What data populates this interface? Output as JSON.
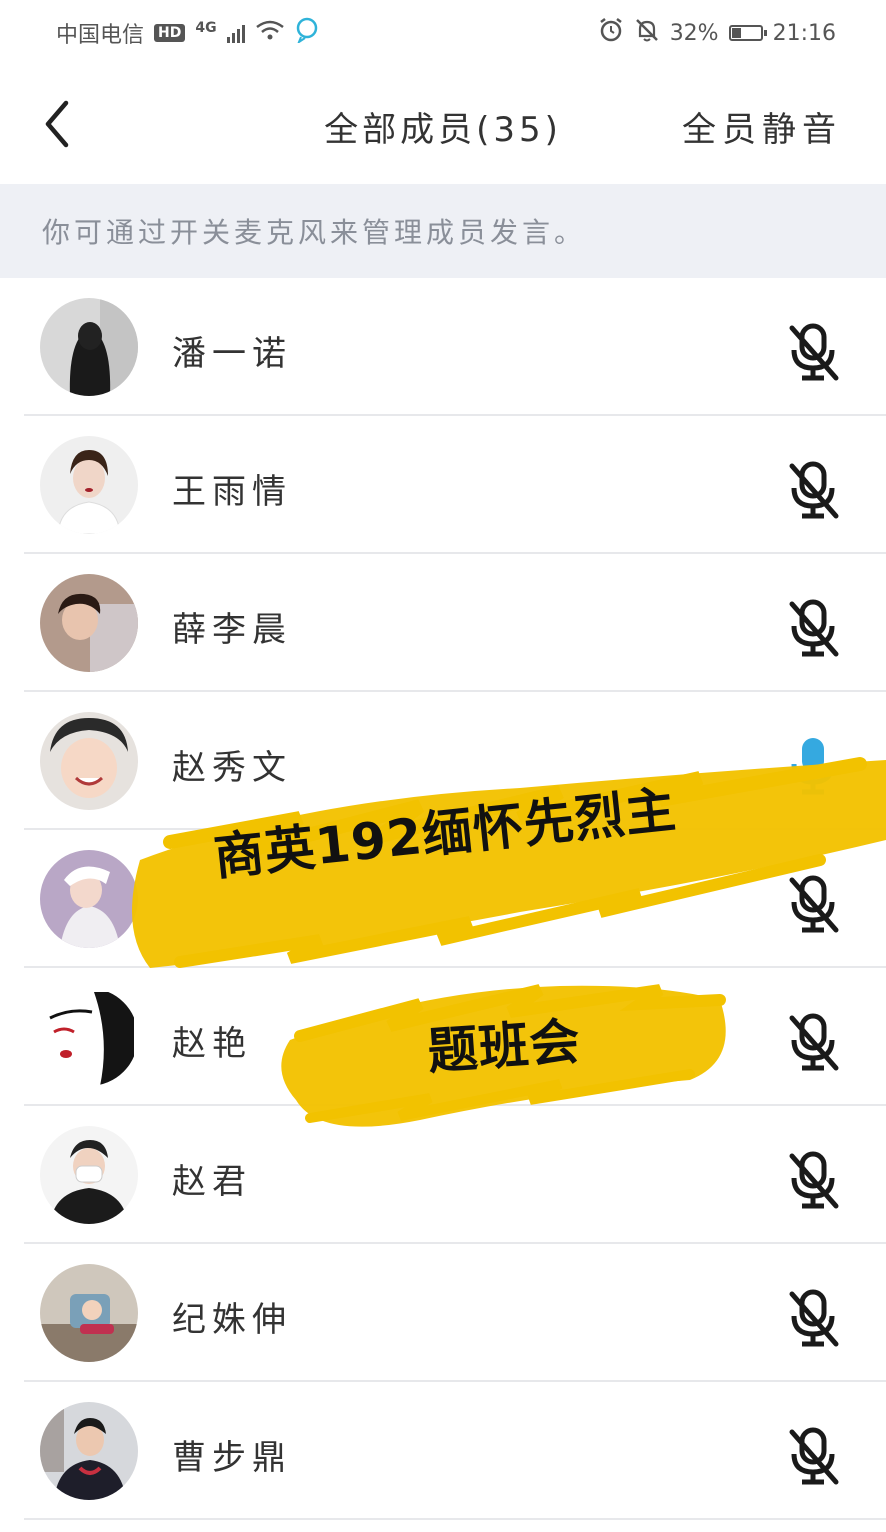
{
  "status_bar": {
    "carrier": "中国电信",
    "hd": "HD",
    "network": "4G",
    "battery_percent": "32%",
    "battery_level": 0.32,
    "time": "21:16"
  },
  "header": {
    "title": "全部成员(35)",
    "mute_all_label": "全员静音"
  },
  "hint": "你可通过开关麦克风来管理成员发言。",
  "members": [
    {
      "name": "潘一诺",
      "mic": "muted"
    },
    {
      "name": "王雨情",
      "mic": "muted"
    },
    {
      "name": "薛李晨",
      "mic": "muted"
    },
    {
      "name": "赵秀文",
      "mic": "on"
    },
    {
      "name": "",
      "mic": "muted"
    },
    {
      "name": "赵艳",
      "mic": "muted"
    },
    {
      "name": "赵君",
      "mic": "muted"
    },
    {
      "name": "纪姝伸",
      "mic": "muted"
    },
    {
      "name": "曹步鼎",
      "mic": "muted"
    }
  ],
  "overlay": {
    "line1": "商英192缅怀先烈主",
    "line2": "题班会",
    "brush_color": "#f2c200"
  },
  "colors": {
    "mic_on": "#35a9e0",
    "mic_off": "#1a1a1a",
    "divider": "#e7e8eb",
    "hint_bg": "#eef0f5"
  }
}
